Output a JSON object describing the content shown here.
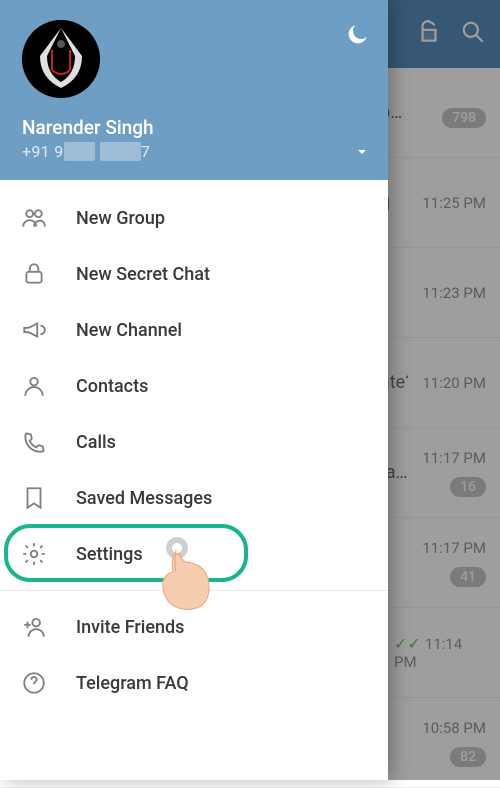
{
  "profile": {
    "name": "Narender Singh",
    "phone_prefix": "+91 9",
    "phone_suffix": "7"
  },
  "menu": {
    "new_group": "New Group",
    "new_secret_chat": "New Secret Chat",
    "new_channel": "New Channel",
    "contacts": "Contacts",
    "calls": "Calls",
    "saved_messages": "Saved Messages",
    "settings": "Settings",
    "invite_friends": "Invite Friends",
    "telegram_faq": "Telegram FAQ"
  },
  "chats": [
    {
      "fragment": "o…",
      "time": "",
      "badge": "798"
    },
    {
      "fragment": "g",
      "time": "11:25 PM",
      "badge": ""
    },
    {
      "fragment": "",
      "time": "11:23 PM",
      "badge": ""
    },
    {
      "fragment": "ate? N…",
      "time": "11:20 PM",
      "badge": ""
    },
    {
      "fragment": "ra…",
      "time": "11:17 PM",
      "badge": "16"
    },
    {
      "fragment": "",
      "time": "11:17 PM",
      "badge": "41"
    },
    {
      "fragment": "",
      "time": "11:14 PM",
      "badge": "",
      "ticks": true
    },
    {
      "fragment": "",
      "time": "10:58 PM",
      "badge": "82"
    }
  ],
  "colors": {
    "header": "#6f9ec4",
    "accent_highlight": "#19b58e"
  }
}
